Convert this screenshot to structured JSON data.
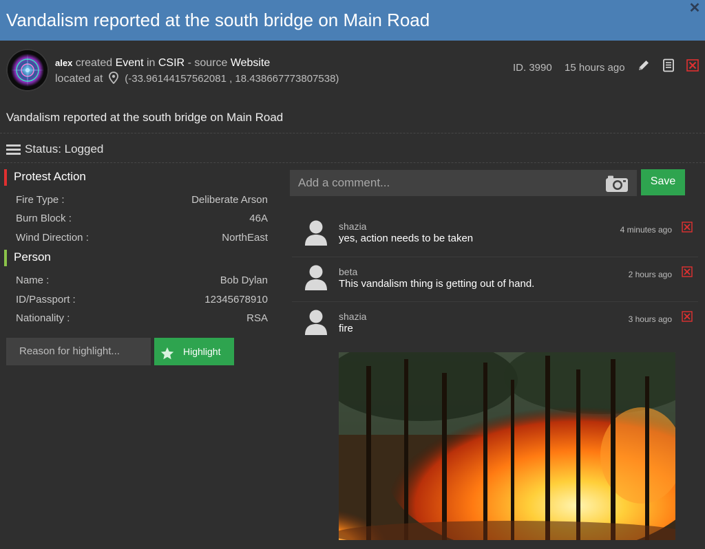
{
  "header": {
    "title": "Vandalism reported at the south bridge on Main Road",
    "close_icon": "close-icon"
  },
  "meta": {
    "user": "alex",
    "created": "created",
    "type": "Event",
    "in": "in",
    "org": "CSIR",
    "source_label": "- source",
    "source": "Website",
    "located_at": "located at",
    "coords": "(-33.96144157562081 , 18.438667773807538)",
    "id": "ID. 3990",
    "ago": "15 hours ago"
  },
  "description": "Vandalism reported at the south bridge on Main Road",
  "status": "Status: Logged",
  "sections": [
    {
      "title": "Protest Action",
      "color": "#e03030",
      "fields": [
        {
          "key": "Fire Type :",
          "value": "Deliberate Arson"
        },
        {
          "key": "Burn Block :",
          "value": "46A"
        },
        {
          "key": "Wind Direction :",
          "value": "NorthEast"
        }
      ]
    },
    {
      "title": "Person",
      "color": "#8bc34a",
      "fields": [
        {
          "key": "Name :",
          "value": "Bob Dylan"
        },
        {
          "key": "ID/Passport :",
          "value": "12345678910"
        },
        {
          "key": "Nationality :",
          "value": "RSA"
        }
      ]
    }
  ],
  "highlight": {
    "placeholder": "Reason for highlight...",
    "button": "Highlight"
  },
  "comment_box": {
    "placeholder": "Add a comment...",
    "save": "Save"
  },
  "comments": [
    {
      "user": "shazia",
      "text": "yes, action needs to be taken",
      "time": "4 minutes ago"
    },
    {
      "user": "beta",
      "text": "This vandalism thing is getting out of hand.",
      "time": "2 hours ago"
    },
    {
      "user": "shazia",
      "text": "fire",
      "time": "3 hours ago",
      "has_image": true
    }
  ],
  "colors": {
    "accent": "#4a7fb5",
    "success": "#2ea44f",
    "danger": "#e03030"
  }
}
